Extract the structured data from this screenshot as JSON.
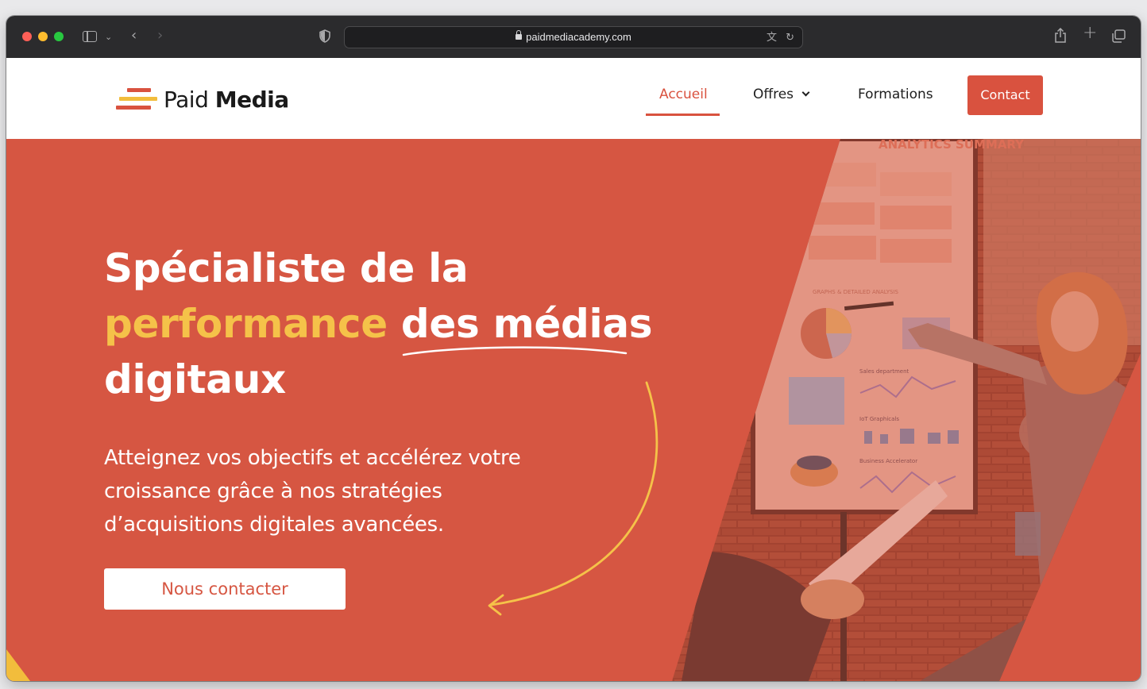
{
  "browser": {
    "url": "paidmediacademy.com"
  },
  "site": {
    "logo": {
      "word1": "Paid",
      "word2": "Media"
    },
    "nav": {
      "home": "Accueil",
      "offers": "Offres",
      "trainings": "Formations",
      "contact": "Contact"
    }
  },
  "hero": {
    "title_part1": "Spécialiste de la",
    "title_accent": "performance",
    "title_part2": "des médias",
    "title_part3": "digitaux",
    "subtitle": "Atteignez vos objectifs et accélérez votre croissance grâce à nos stratégies d’acquisitions digitales avancées.",
    "cta": "Nous contacter"
  },
  "photo": {
    "board_title": "ANALYTICS SUMMARY",
    "board_subtitle": "GRAPHS & DETAILED ANALYSIS",
    "labels": [
      "Sales department",
      "IoT Graphicals",
      "Business Accelerator"
    ]
  },
  "colors": {
    "brand": "#d65642",
    "accent": "#f5c249"
  }
}
